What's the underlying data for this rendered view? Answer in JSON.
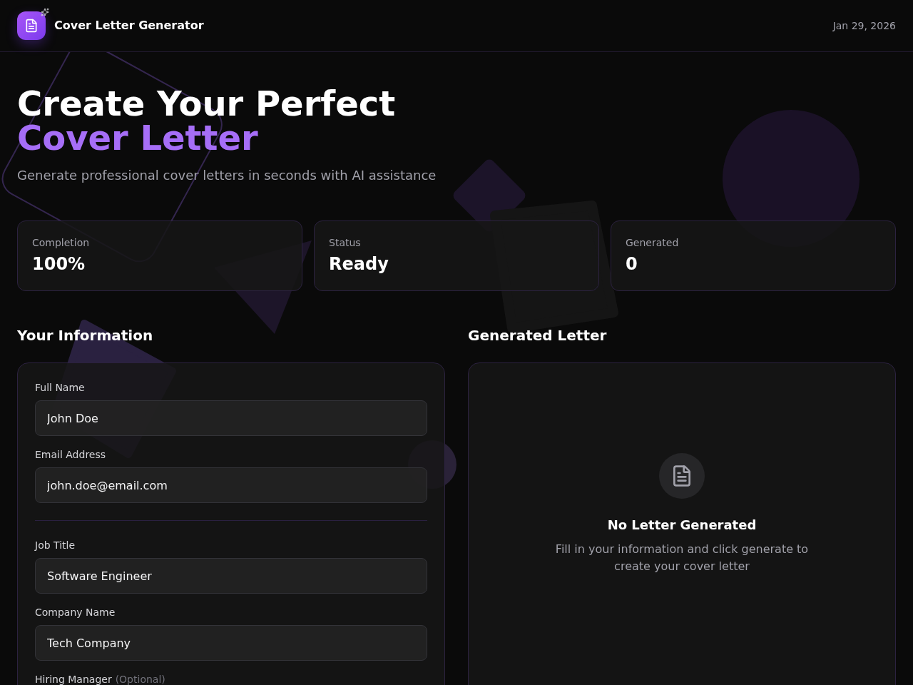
{
  "header": {
    "title": "Cover Letter Generator",
    "date": "Jan 29, 2026"
  },
  "hero": {
    "title_line_1": "Create Your Perfect",
    "title_line_2": "Cover Letter",
    "subtitle": "Generate professional cover letters in seconds with AI assistance"
  },
  "stats": [
    {
      "label": "Completion",
      "value": "100%"
    },
    {
      "label": "Status",
      "value": "Ready"
    },
    {
      "label": "Generated",
      "value": "0"
    }
  ],
  "form": {
    "heading": "Your Information",
    "sections": [
      {
        "fields": [
          {
            "label": "Full Name",
            "value": "John Doe"
          },
          {
            "label": "Email Address",
            "value": "john.doe@email.com"
          }
        ]
      },
      {
        "fields": [
          {
            "label": "Job Title",
            "value": "Software Engineer"
          },
          {
            "label": "Company Name",
            "value": "Tech Company"
          },
          {
            "label": "Hiring Manager",
            "note": "(Optional)"
          }
        ]
      }
    ]
  },
  "letter": {
    "heading": "Generated Letter",
    "empty_title": "No Letter Generated",
    "empty_message": "Fill in your information and click generate to create your cover letter"
  }
}
